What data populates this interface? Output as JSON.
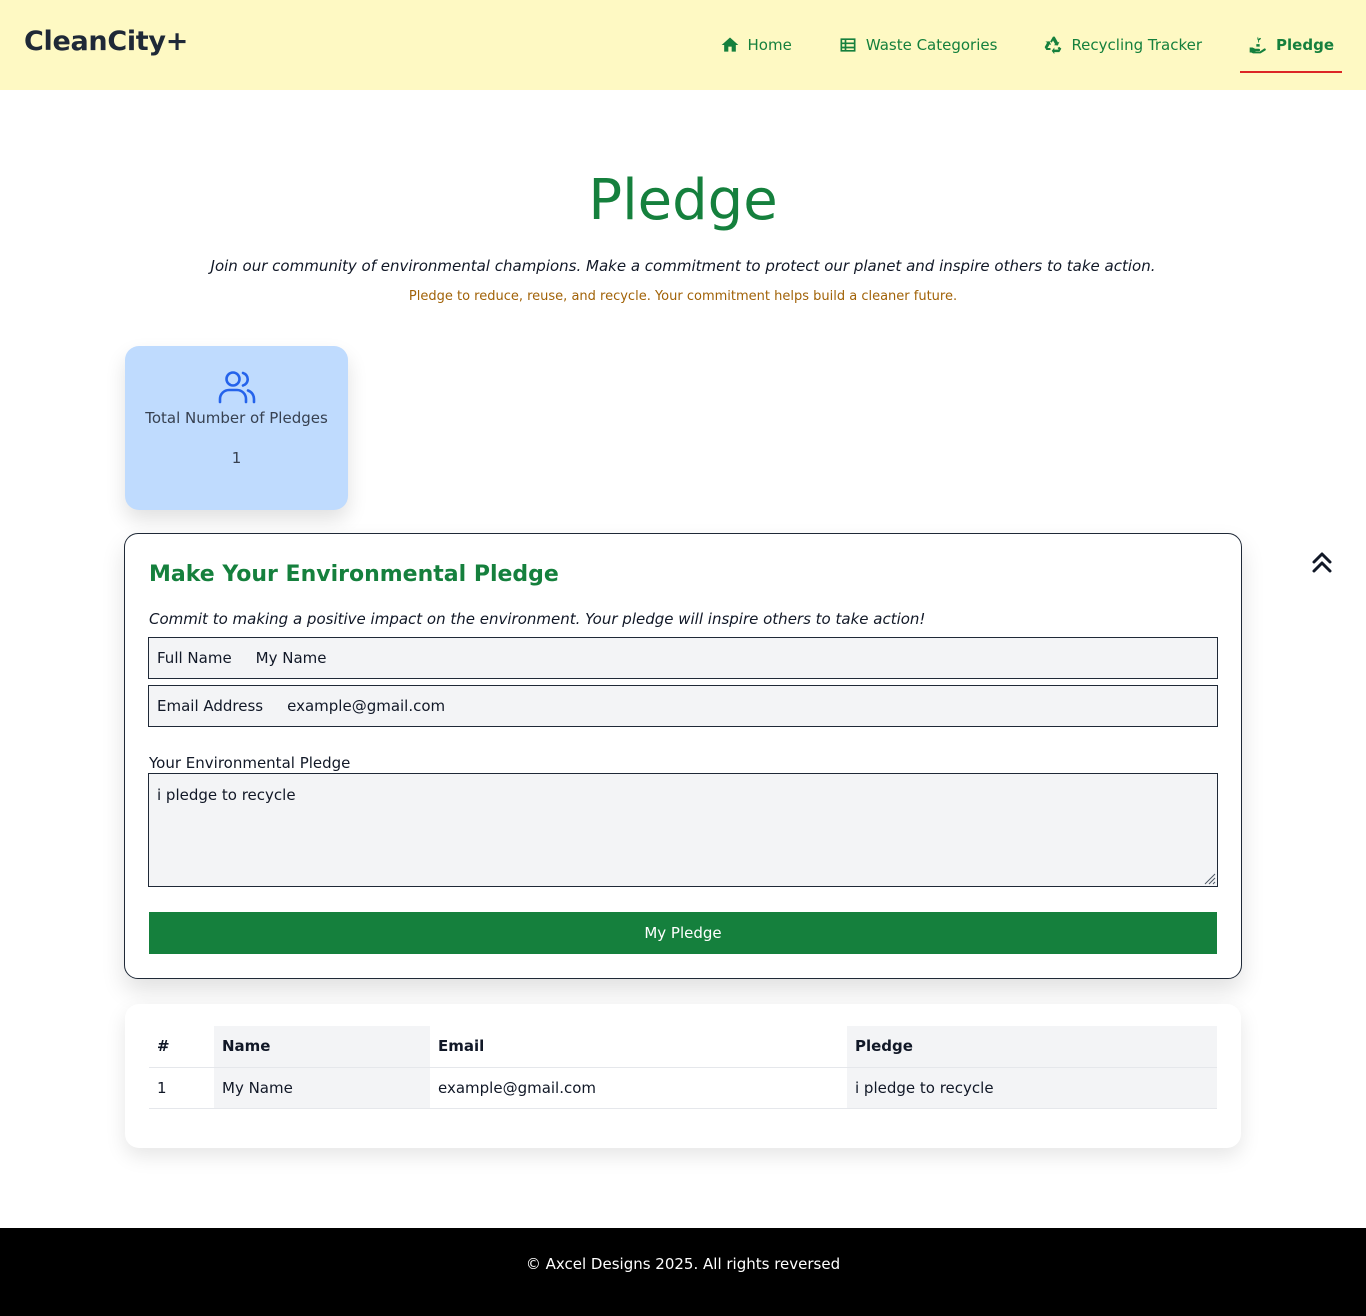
{
  "brand": "CleanCity+",
  "nav": [
    {
      "label": "Home",
      "icon": "home-icon"
    },
    {
      "label": "Waste Categories",
      "icon": "list-icon"
    },
    {
      "label": "Recycling Tracker",
      "icon": "recycle-icon"
    },
    {
      "label": "Pledge",
      "icon": "hand-seedling-icon",
      "active": true
    }
  ],
  "hero": {
    "title": "Pledge",
    "subtitle": "Join our community of environmental champions. Make a commitment to protect our planet and inspire others to take action.",
    "tagline": "Pledge to reduce, reuse, and recycle. Your commitment helps build a cleaner future."
  },
  "stats": {
    "label": "Total Number of Pledges",
    "value": "1",
    "icon": "users-icon"
  },
  "form": {
    "title": "Make Your Environmental Pledge",
    "description": "Commit to making a positive impact on the environment. Your pledge will inspire others to take action!",
    "name_label": "Full Name",
    "name_value": "My Name",
    "email_label": "Email Address",
    "email_value": "example@gmail.com",
    "pledge_label": "Your Environmental Pledge",
    "pledge_value": "i pledge to recycle",
    "submit_label": "My Pledge"
  },
  "table": {
    "headers": [
      "#",
      "Name",
      "Email",
      "Pledge"
    ],
    "rows": [
      [
        "1",
        "My Name",
        "example@gmail.com",
        "i pledge to recycle"
      ]
    ]
  },
  "footer": {
    "text": "© Axcel Designs 2025. All rights reversed"
  },
  "colors": {
    "nav_bg": "#fef9c3",
    "accent_green": "#15803d",
    "active_underline": "#dc2626",
    "stat_card_bg": "#bfdbfe",
    "tagline": "#a16207",
    "footer_bg": "#000000"
  }
}
